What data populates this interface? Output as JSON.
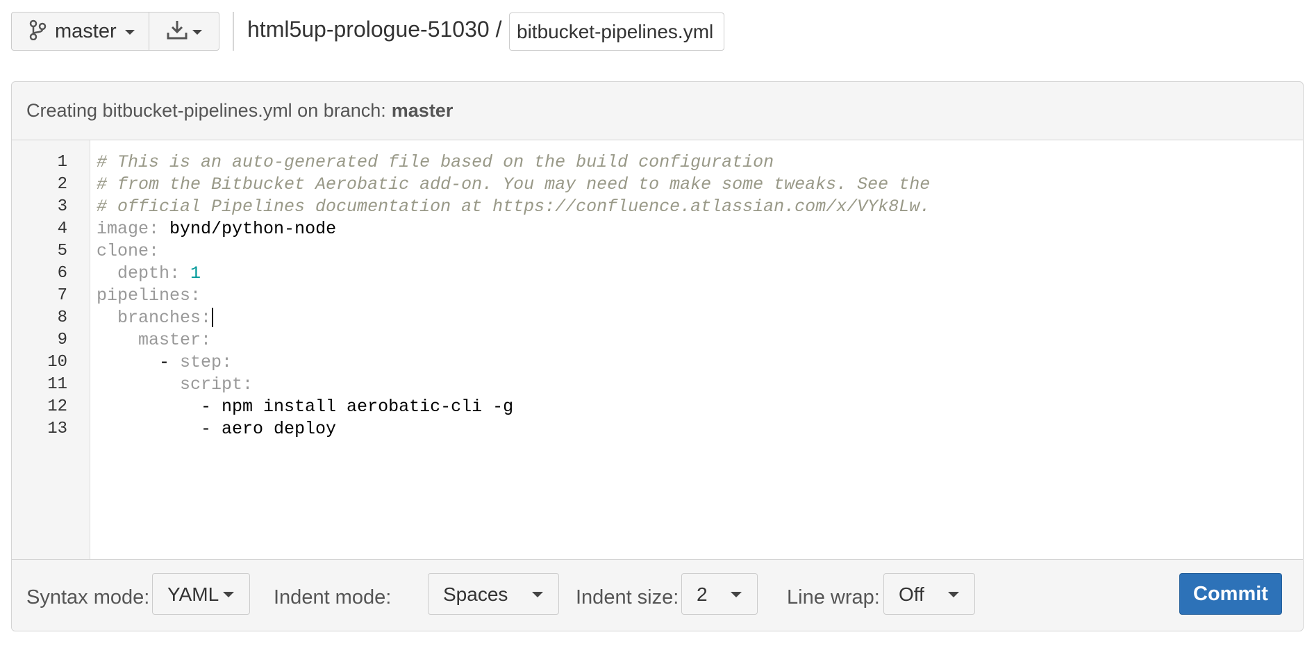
{
  "toolbar": {
    "branch_label": "master",
    "branch_icon": "branch-icon",
    "download_icon": "download-icon",
    "repo_path": "html5up-prologue-51030 /",
    "filename": "bitbucket-pipelines.yml"
  },
  "panel": {
    "header_prefix": "Creating bitbucket-pipelines.yml on branch:",
    "header_branch": "master"
  },
  "editor": {
    "line_numbers": [
      "1",
      "2",
      "3",
      "4",
      "5",
      "6",
      "7",
      "8",
      "9",
      "10",
      "11",
      "12",
      "13"
    ],
    "lines": [
      [
        {
          "t": "# This is an auto-generated file based on the build configuration",
          "c": "cm"
        }
      ],
      [
        {
          "t": "# from the Bitbucket Aerobatic add-on. You may need to make some tweaks. See the",
          "c": "cm"
        }
      ],
      [
        {
          "t": "# official Pipelines documentation at https://confluence.atlassian.com/x/VYk8Lw.",
          "c": "cm"
        }
      ],
      [
        {
          "t": "image: ",
          "c": "key"
        },
        {
          "t": "bynd/python-node",
          "c": "val"
        }
      ],
      [
        {
          "t": "clone:",
          "c": "key"
        }
      ],
      [
        {
          "t": "  depth: ",
          "c": "key"
        },
        {
          "t": "1",
          "c": "num"
        }
      ],
      [
        {
          "t": "pipelines:",
          "c": "key"
        }
      ],
      [
        {
          "t": "  branches:",
          "c": "key"
        }
      ],
      [
        {
          "t": "    master:",
          "c": "key"
        }
      ],
      [
        {
          "t": "      ",
          "c": "key"
        },
        {
          "t": "- ",
          "c": "val"
        },
        {
          "t": "step:",
          "c": "key"
        }
      ],
      [
        {
          "t": "        script:",
          "c": "key"
        }
      ],
      [
        {
          "t": "          - npm install aerobatic-cli -g",
          "c": "val"
        }
      ],
      [
        {
          "t": "          - aero deploy",
          "c": "val"
        }
      ]
    ],
    "cursor_line": 8
  },
  "footer": {
    "syntax_label": "Syntax mode:",
    "syntax_value": "YAML",
    "indent_mode_label": "Indent mode:",
    "indent_mode_value": "Spaces",
    "indent_size_label": "Indent size:",
    "indent_size_value": "2",
    "line_wrap_label": "Line wrap:",
    "line_wrap_value": "Off",
    "commit_label": "Commit"
  },
  "colors": {
    "commit_button": "#2d72b8",
    "comment": "#999988",
    "yaml_key": "#999999",
    "number": "#009999"
  }
}
